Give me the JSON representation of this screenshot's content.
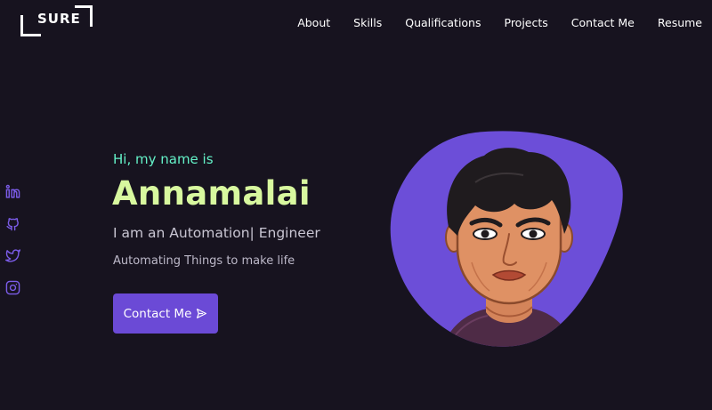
{
  "logo": {
    "text": "SURE"
  },
  "nav": {
    "items": [
      "About",
      "Skills",
      "Qualifications",
      "Projects",
      "Contact Me",
      "Resume"
    ]
  },
  "social": [
    "linkedin-icon",
    "github-icon",
    "twitter-icon",
    "instagram-icon"
  ],
  "hero": {
    "greeting": "Hi, my name is",
    "name": "Annamalai",
    "role": "I am an Automation| Engineer",
    "tagline": "Automating Things to make life",
    "cta_label": "Contact Me"
  },
  "colors": {
    "background": "#17131f",
    "accent": "#6b4ad6",
    "greeting": "#64f2c8",
    "name": "#d8f89f"
  }
}
